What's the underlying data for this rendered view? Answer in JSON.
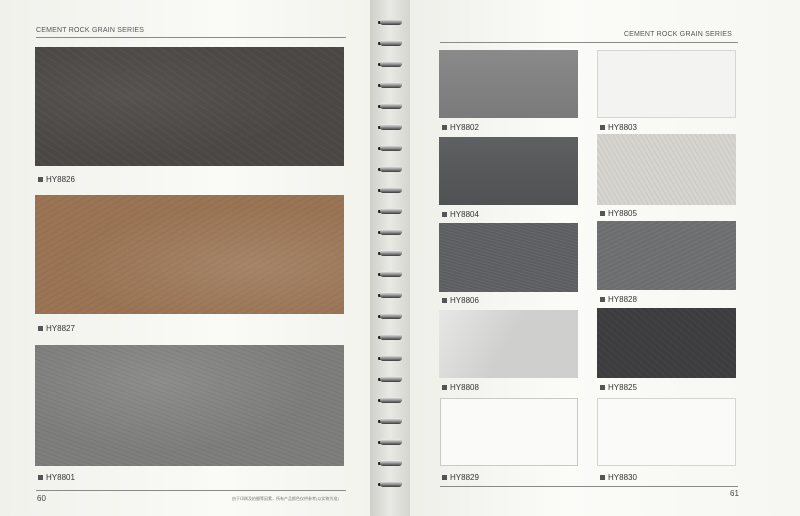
{
  "left_page": {
    "series_title": "CEMENT ROCK GRAIN SERIES",
    "page_number": "60",
    "footnote": "由于印刷及拍摄等因素，所有产品颜色仅供参考(以实物为准)",
    "samples": [
      {
        "code": "HY8826"
      },
      {
        "code": "HY8827"
      },
      {
        "code": "HY8801"
      }
    ]
  },
  "right_page": {
    "series_title": "CEMENT ROCK GRAIN SERIES",
    "page_number": "61",
    "samples": [
      {
        "code": "HY8802"
      },
      {
        "code": "HY8803"
      },
      {
        "code": "HY8804"
      },
      {
        "code": "HY8805"
      },
      {
        "code": "HY8806"
      },
      {
        "code": "HY8828"
      },
      {
        "code": "HY8808"
      },
      {
        "code": "HY8825"
      },
      {
        "code": "HY8829"
      },
      {
        "code": "HY8830"
      }
    ]
  },
  "colors": {
    "HY8826": "#4b4745",
    "HY8827": "#9a7454",
    "HY8801": "#7e7e7c",
    "HY8802": "#838383",
    "HY8803": "#f3f3f1",
    "HY8804": "#58595b",
    "HY8805": "#d6d4cf",
    "HY8806": "#5c5e61",
    "HY8828": "#6d6e70",
    "HY8808": "#cfcfcd",
    "HY8825": "#3d3d3f",
    "HY8829": "#fafaf8",
    "HY8830": "#fafaf8"
  }
}
